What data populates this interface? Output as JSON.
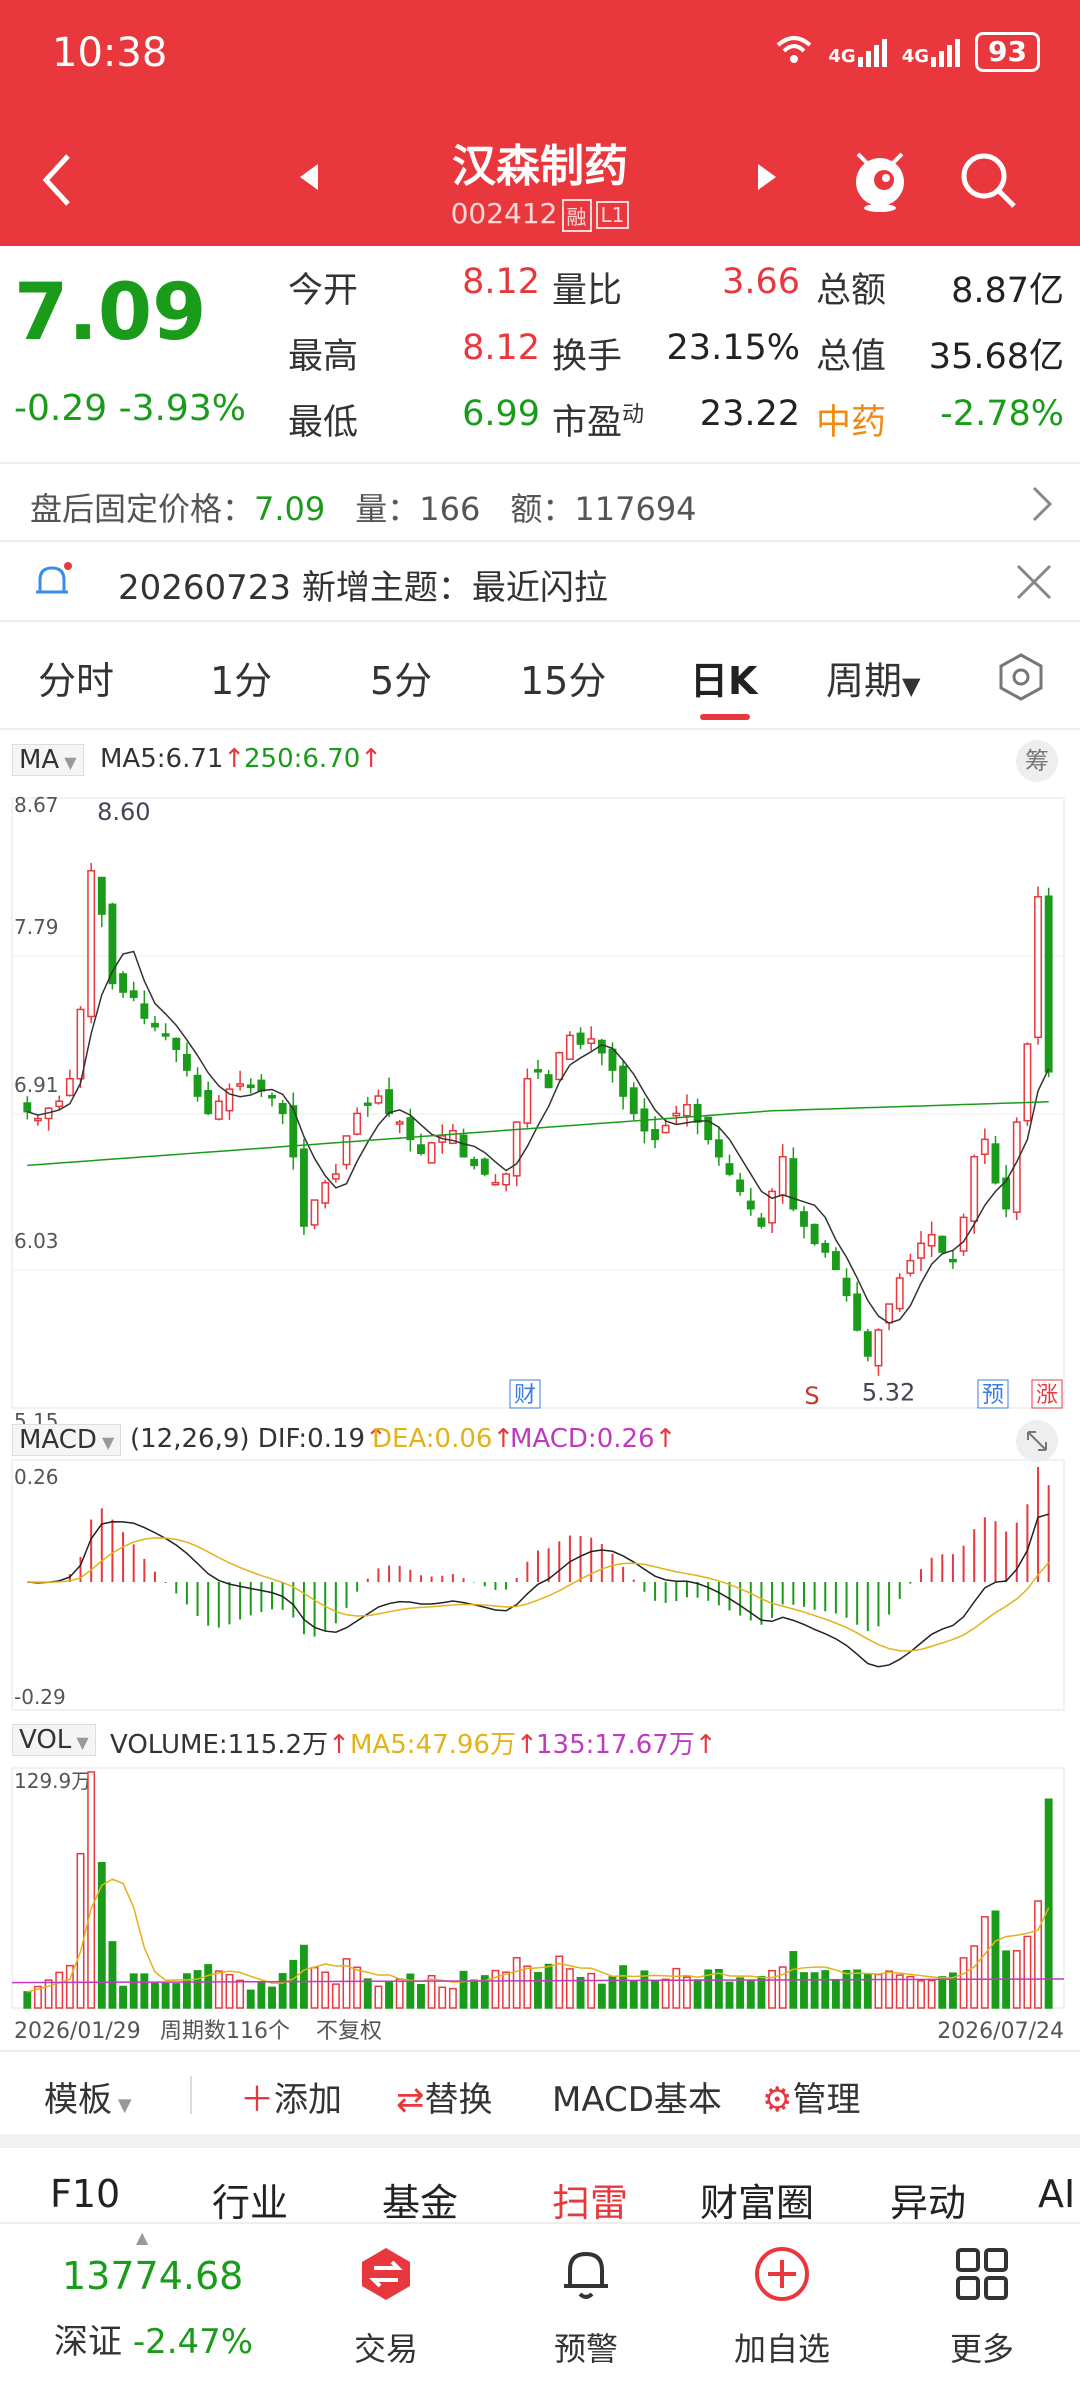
{
  "status": {
    "time": "10:38",
    "signal1": "4G",
    "signal2": "4G",
    "battery": "93"
  },
  "header": {
    "title": "汉森制药",
    "code": "002412",
    "tag1": "融",
    "tag2": "L1"
  },
  "quote": {
    "price": "7.09",
    "change": "-0.29  -3.93%",
    "rows": [
      {
        "l1": "今开",
        "v1": "8.12",
        "l2": "量比",
        "v2": "3.66",
        "l3": "总额",
        "v3": "8.87亿"
      },
      {
        "l1": "最高",
        "v1": "8.12",
        "l2": "换手",
        "v2": "23.15%",
        "l3": "总值",
        "v3": "35.68亿"
      },
      {
        "l1": "最低",
        "v1": "6.99",
        "l2": "市盈",
        "v2": "23.22",
        "l3": "中药",
        "v3": "-2.78%"
      }
    ],
    "pe_sup": "动"
  },
  "fixed_price": {
    "label": "盘后固定价格：",
    "price": "7.09",
    "vol_label": "量：",
    "vol": "166",
    "amt_label": "额：",
    "amt": "117694"
  },
  "notice": {
    "text": "20260723 新增主题：最近闪拉"
  },
  "tabs": [
    "分时",
    "1分",
    "5分",
    "15分",
    "日K",
    "周期"
  ],
  "ma_legend": {
    "name": "MA",
    "ma5": "MA5:6.71",
    "ma250": "250:6.70",
    "chip": "筹"
  },
  "price_axis": {
    "top": "8.67",
    "l2": "7.79",
    "l3": "6.91",
    "l4": "6.03",
    "bottom": "5.15",
    "high_label": "8.60",
    "low_label": "5.32"
  },
  "markers": {
    "cai": "财",
    "s": "S",
    "yu": "预",
    "zhang": "涨"
  },
  "macd_legend": {
    "name": "MACD",
    "params": "(12,26,9)",
    "dif": "DIF:0.19",
    "dea": "DEA:0.06",
    "macd": "MACD:0.26",
    "top": "0.26",
    "bottom": "-0.29"
  },
  "vol_legend": {
    "name": "VOL",
    "volume": "VOLUME:115.2万",
    "ma5": "MA5:47.96万",
    "ma135": "135:17.67万",
    "top": "129.9万"
  },
  "date_axis": {
    "start": "2026/01/29",
    "count": "周期数116个",
    "adj": "不复权",
    "end": "2026/07/24"
  },
  "toolbar": {
    "template": "模板",
    "add": "添加",
    "replace": "替换",
    "indicator": "MACD基本",
    "manage": "管理"
  },
  "functions": [
    "F10",
    "行业",
    "基金",
    "扫雷",
    "财富圈",
    "异动",
    "AI"
  ],
  "index": {
    "value": "13774.68",
    "name": "深证",
    "change": "-2.47%"
  },
  "nav": {
    "trade": "交易",
    "alert": "预警",
    "add": "加自选",
    "more": "更多"
  },
  "chart_data": {
    "type": "candlestick",
    "title": "",
    "yrange": [
      5.15,
      8.67
    ],
    "closes": [
      6.86,
      6.82,
      6.88,
      6.92,
      7.05,
      7.45,
      8.25,
      8.0,
      7.6,
      7.55,
      7.52,
      7.4,
      7.35,
      7.3,
      7.22,
      7.1,
      6.95,
      6.85,
      6.92,
      6.99,
      7.02,
      7.0,
      6.98,
      6.95,
      6.85,
      6.6,
      6.2,
      6.35,
      6.45,
      6.5,
      6.72,
      6.85,
      6.9,
      6.95,
      6.85,
      6.8,
      6.7,
      6.62,
      6.68,
      6.72,
      6.75,
      6.6,
      6.55,
      6.5,
      6.45,
      6.5,
      6.8,
      7.05,
      7.1,
      7.0,
      7.2,
      7.3,
      7.25,
      7.28,
      7.2,
      7.1,
      6.95,
      6.85,
      6.75,
      6.7,
      6.78,
      6.85,
      6.9,
      6.8,
      6.7,
      6.6,
      6.5,
      6.4,
      6.3,
      6.2,
      6.4,
      6.6,
      6.3,
      6.2,
      6.1,
      6.05,
      5.95,
      5.8,
      5.6,
      5.45,
      5.6,
      5.75,
      5.9,
      6.0,
      6.1,
      6.15,
      6.05,
      6.0,
      6.25,
      6.6,
      6.7,
      6.45,
      6.3,
      6.8,
      7.25,
      8.1,
      7.09
    ]
  }
}
